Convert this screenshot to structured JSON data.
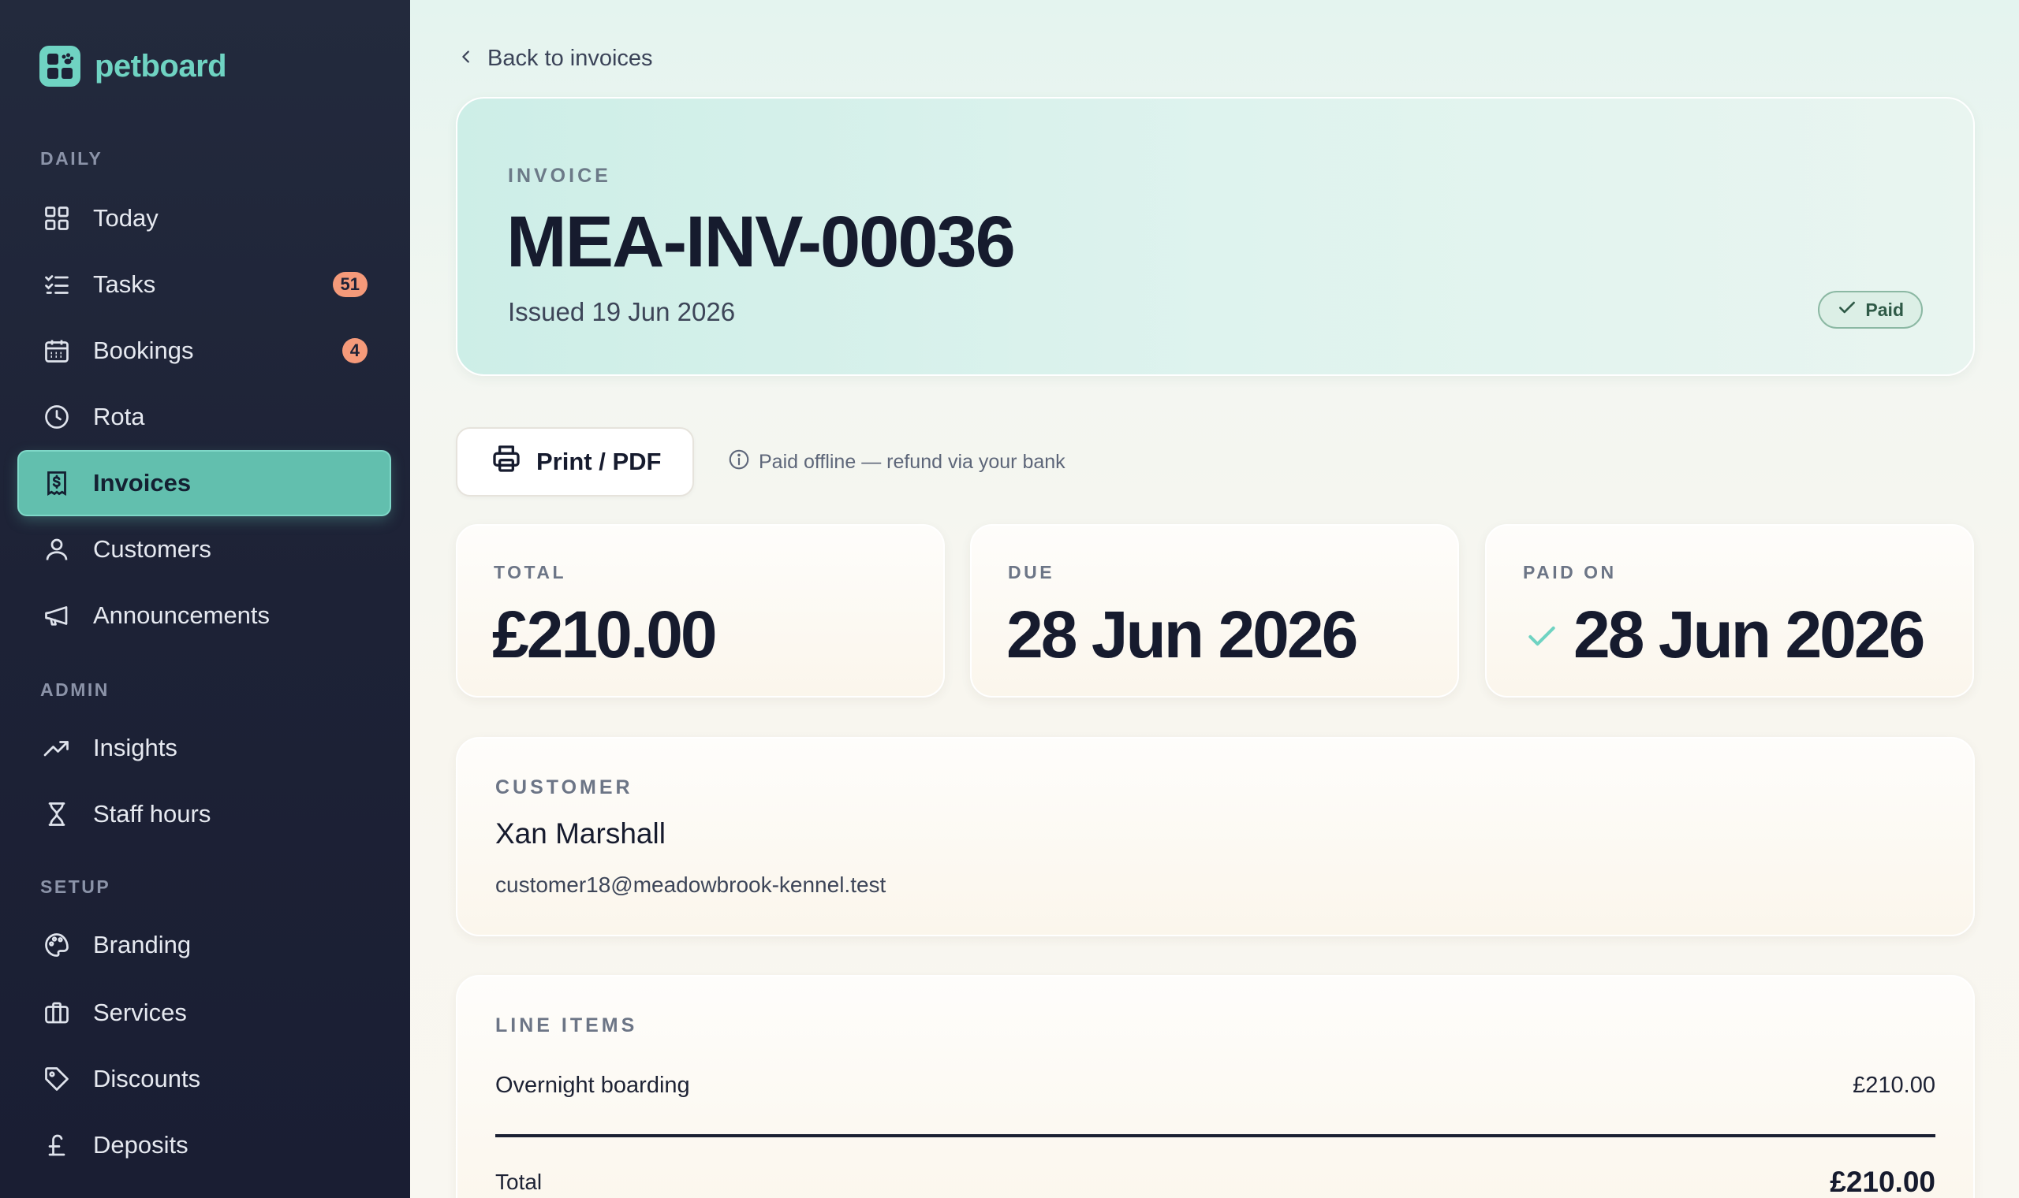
{
  "brand": {
    "name": "petboard",
    "logo_icon": "paw-icon"
  },
  "sidebar": {
    "sections": {
      "daily": "DAILY",
      "admin": "ADMIN",
      "setup": "SETUP"
    },
    "items": [
      {
        "label": "Today",
        "icon": "grid-icon"
      },
      {
        "label": "Tasks",
        "icon": "checklist-icon",
        "badge": "51"
      },
      {
        "label": "Bookings",
        "icon": "calendar-icon",
        "badge": "4"
      },
      {
        "label": "Rota",
        "icon": "clock-icon"
      },
      {
        "label": "Invoices",
        "icon": "receipt-icon",
        "active": true
      },
      {
        "label": "Customers",
        "icon": "user-icon"
      },
      {
        "label": "Announcements",
        "icon": "megaphone-icon"
      },
      {
        "label": "Insights",
        "icon": "trend-icon"
      },
      {
        "label": "Staff hours",
        "icon": "hourglass-icon"
      },
      {
        "label": "Branding",
        "icon": "palette-icon"
      },
      {
        "label": "Services",
        "icon": "briefcase-icon"
      },
      {
        "label": "Discounts",
        "icon": "tag-icon"
      },
      {
        "label": "Deposits",
        "icon": "pound-icon"
      }
    ],
    "active_color": "#62bfae",
    "badge_color": "#f59a7a"
  },
  "main": {
    "back_label": "Back to invoices",
    "invoice": {
      "kicker": "INVOICE",
      "number": "MEA-INV-00036",
      "issued": "Issued 19 Jun 2026",
      "status": "Paid"
    },
    "print_label": "Print / PDF",
    "offline_note": "Paid offline — refund via your bank",
    "stats": {
      "total": {
        "label": "TOTAL",
        "value": "£210.00"
      },
      "due": {
        "label": "DUE",
        "value": "28 Jun 2026"
      },
      "paid_on": {
        "label": "PAID ON",
        "value": "28 Jun 2026"
      }
    },
    "customer": {
      "kicker": "CUSTOMER",
      "name": "Xan Marshall",
      "email": "customer18@meadowbrook-kennel.test"
    },
    "line_items": {
      "kicker": "LINE ITEMS",
      "items": [
        {
          "name": "Overnight boarding",
          "amount": "£210.00"
        }
      ],
      "total_label": "Total",
      "total_amount": "£210.00"
    }
  }
}
